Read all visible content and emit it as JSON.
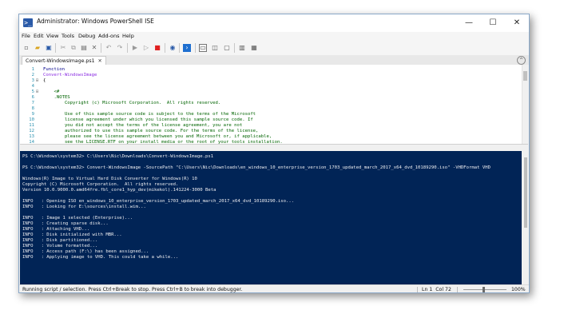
{
  "window": {
    "title": "Administrator: Windows PowerShell ISE",
    "app_icon_glyph": ">_",
    "minimize_glyph": "—",
    "maximize_glyph": "☐",
    "close_glyph": "✕"
  },
  "menu": [
    "File",
    "Edit",
    "View",
    "Tools",
    "Debug",
    "Add-ons",
    "Help"
  ],
  "toolbar": {
    "icons": [
      "new-file-icon",
      "open-folder-icon",
      "save-icon",
      "cut-icon",
      "copy-icon",
      "paste-icon",
      "clear-icon",
      "undo-icon",
      "redo-icon",
      "run-icon",
      "run-selection-icon",
      "stop-icon",
      "remote-powershell-icon",
      "powershell-console-icon",
      "script-pane-top-icon",
      "script-pane-right-icon",
      "script-pane-maximized-icon",
      "show-commands-icon",
      "show-command-addon-icon"
    ]
  },
  "tab": {
    "label": "Convert-WindowsImage.ps1",
    "close_glyph": "✕",
    "collapse_glyph": "^"
  },
  "script": {
    "lines": [
      {
        "num": "1",
        "fold": "",
        "text": "Function",
        "kind": "kw"
      },
      {
        "num": "2",
        "fold": "",
        "text": "Convert-WindowsImage",
        "kind": "fn"
      },
      {
        "num": "3",
        "fold": "⊟",
        "text": "{",
        "kind": "plain"
      },
      {
        "num": "4",
        "fold": "",
        "text": "",
        "kind": "plain"
      },
      {
        "num": "5",
        "fold": "⊟",
        "text": "    <#",
        "kind": "cm"
      },
      {
        "num": "6",
        "fold": "",
        "text": "    .NOTES",
        "kind": "cm"
      },
      {
        "num": "7",
        "fold": "",
        "text": "        Copyright (c) Microsoft Corporation.  All rights reserved.",
        "kind": "cm"
      },
      {
        "num": "8",
        "fold": "",
        "text": "",
        "kind": "cm"
      },
      {
        "num": "9",
        "fold": "",
        "text": "        Use of this sample source code is subject to the terms of the Microsoft",
        "kind": "cm"
      },
      {
        "num": "10",
        "fold": "",
        "text": "        license agreement under which you licensed this sample source code. If",
        "kind": "cm"
      },
      {
        "num": "11",
        "fold": "",
        "text": "        you did not accept the terms of the license agreement, you are not",
        "kind": "cm"
      },
      {
        "num": "12",
        "fold": "",
        "text": "        authorized to use this sample source code. For the terms of the license,",
        "kind": "cm"
      },
      {
        "num": "13",
        "fold": "",
        "text": "        please see the license agreement between you and Microsoft or, if applicable,",
        "kind": "cm"
      },
      {
        "num": "14",
        "fold": "",
        "text": "        see the LICENSE.RTF on your install media or the root of your tools installation.",
        "kind": "cm"
      }
    ]
  },
  "console": {
    "lines": [
      "PS C:\\Windows\\system32> C:\\Users\\Nic\\Downloads\\Convert-WindowsImage.ps1",
      "",
      "PS C:\\Windows\\system32> Convert-WindowsImage -SourcePath \"C:\\Users\\Nic\\Downloads\\en_windows_10_enterprise_version_1703_updated_march_2017_x64_dvd_10189290.iso\" -VHDFormat VHD",
      "",
      "Windows(R) Image to Virtual Hard Disk Converter for Windows(R) 10",
      "Copyright (C) Microsoft Corporation.  All rights reserved.",
      "Version 10.0.9000.0.amd64fre.fbl_core1_hyp_dev(mikekol).141224-3000 Beta",
      "",
      "INFO   : Opening ISO en_windows_10_enterprise_version_1703_updated_march_2017_x64_dvd_10189290.iso...",
      "INFO   : Looking for E:\\sources\\install.wim...",
      "",
      "INFO   : Image 1 selected (Enterprise)...",
      "INFO   : Creating sparse disk...",
      "INFO   : Attaching VHD...",
      "INFO   : Disk initialized with MBR...",
      "INFO   : Disk partitioned...",
      "INFO   : Volume formatted...",
      "INFO   : Access path (F:\\) has been assigned...",
      "INFO   : Applying image to VHD. This could take a while..."
    ]
  },
  "status": {
    "message": "Running script / selection.  Press Ctrl+Break to stop.  Press Ctrl+B to break into debugger.",
    "line": "Ln 1",
    "col": "Col 72",
    "zoom": "100%"
  },
  "colors": {
    "console_bg": "#012456",
    "console_fg": "#eeedf0",
    "keyword": "#00008b",
    "function_name": "#8a2be2",
    "comment": "#006400",
    "line_number": "#2b91af"
  }
}
